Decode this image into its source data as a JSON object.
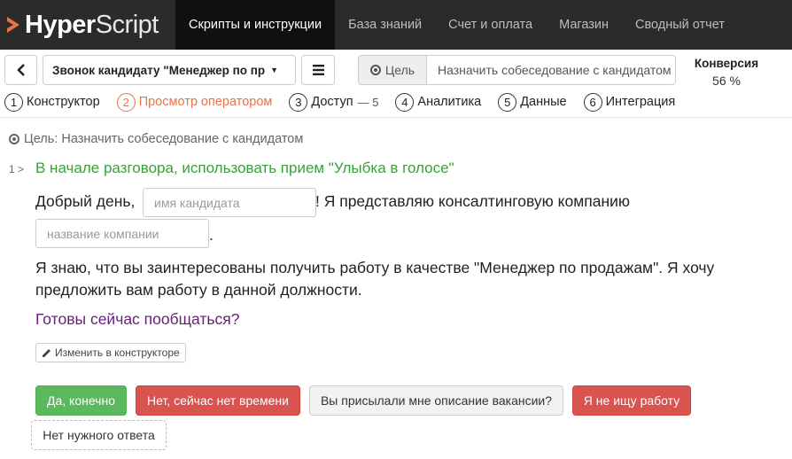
{
  "brand": {
    "bold": "Hyper",
    "light": "Script"
  },
  "nav": {
    "items": [
      {
        "label": "Скрипты и инструкции",
        "active": true
      },
      {
        "label": "База знаний"
      },
      {
        "label": "Счет и оплата"
      },
      {
        "label": "Магазин"
      },
      {
        "label": "Сводный отчет"
      }
    ]
  },
  "toolbar": {
    "back_icon": "chevron-left-icon",
    "script_name": "Звонок кандидату \"Менеджер по пр",
    "menu_icon": "hamburger-icon",
    "goal_label": "Цель",
    "goal_value": "Назначить собеседование с кандидатом"
  },
  "conversion": {
    "title": "Конверсия",
    "value": "56 %"
  },
  "steps": [
    {
      "num": "1",
      "label": "Конструктор"
    },
    {
      "num": "2",
      "label": "Просмотр оператором",
      "active": true
    },
    {
      "num": "3",
      "label": "Доступ",
      "extra": "— 5"
    },
    {
      "num": "4",
      "label": "Аналитика"
    },
    {
      "num": "5",
      "label": "Данные"
    },
    {
      "num": "6",
      "label": "Интеграция"
    }
  ],
  "content": {
    "goal_line": "Цель: Назначить собеседование с кандидатом",
    "node_number": "1 >",
    "node_title": "В начале разговора, использовать прием \"Улыбка в голосе\"",
    "greeting_prefix": "Добрый день,",
    "candidate_placeholder": "имя кандидата",
    "greeting_suffix": "! Я представляю консалтинговую компанию",
    "company_placeholder": "название компании",
    "company_suffix": ".",
    "paragraph_line1": "Я знаю, что вы заинтересованы получить работу в качестве \"Менеджер по продажам\". Я хочу",
    "paragraph_line2": "предложить вам работу в данной должности.",
    "question": "Готовы сейчас пообщаться?",
    "edit_label": "Изменить в конструкторе"
  },
  "answers": {
    "yes": "Да, конечно",
    "no_time": "Нет, сейчас нет времени",
    "vacancy": "Вы присылали мне описание вакансии?",
    "not_looking": "Я не ищу работу",
    "none": "Нет нужного ответа"
  },
  "colors": {
    "navbar": "#2b2b2b",
    "active_step": "#e8734a",
    "node_title": "#3a9f3a",
    "question": "#6a1b7a",
    "success": "#5cb85c",
    "danger": "#d9534f"
  }
}
